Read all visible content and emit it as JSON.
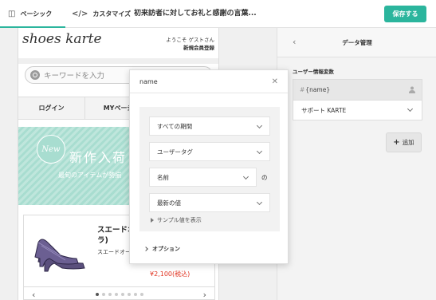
{
  "topbar": {
    "tabs": [
      {
        "label": "ベーシック",
        "icon": "layout-icon"
      },
      {
        "label": "カスタマイズ",
        "icon": "code-icon"
      }
    ],
    "doc_title": "初来訪者に対してお礼と感謝の言葉...",
    "save_label": "保存する"
  },
  "site": {
    "logo": "shoes karte",
    "welcome": "ようこそ ゲストさん",
    "register": "新規会員登録",
    "search_placeholder": "キーワードを入力",
    "nav": [
      "ログイン",
      "MYページ",
      ""
    ],
    "banner": {
      "badge": "New",
      "title": "新作入荷",
      "subtitle": "最旬のアイテムが勢揃"
    },
    "product": {
      "name_line1": "スエードオ",
      "name_line2": "ラ)",
      "subtitle": "スエードオー",
      "price": "¥2,100(税込)",
      "dots": 8,
      "active_dot": 0
    }
  },
  "panel": {
    "title": "データ管理",
    "var_label": "ユーザー情報変数",
    "var_hash": "#",
    "var_name": "{name}",
    "source": "サポート KARTE",
    "add_label": "追加"
  },
  "popover": {
    "title": "name",
    "period": "すべての期間",
    "tag": "ユーザータグ",
    "field": "名前",
    "no": "の",
    "value": "最新の値",
    "sample": "サンプル値を表示",
    "option": "オプション"
  },
  "colors": {
    "accent": "#2bb59d",
    "price": "#e0311e"
  }
}
